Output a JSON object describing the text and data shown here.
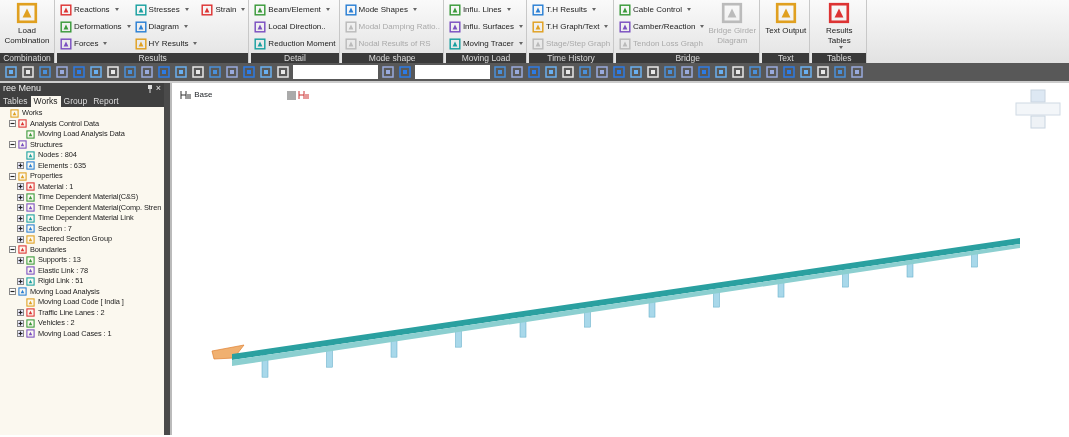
{
  "ribbon": {
    "groups": [
      {
        "label": "Combination",
        "columns": [
          [
            {
              "kind": "large",
              "label": "Load Combination",
              "dropdown": false,
              "disabled": false
            }
          ]
        ]
      },
      {
        "label": "Results",
        "columns": [
          [
            {
              "kind": "small",
              "label": "Reactions",
              "dropdown": true,
              "disabled": false
            },
            {
              "kind": "small",
              "label": "Deformations",
              "dropdown": true,
              "disabled": false
            },
            {
              "kind": "small",
              "label": "Forces",
              "dropdown": true,
              "disabled": false
            }
          ],
          [
            {
              "kind": "small",
              "label": "Stresses",
              "dropdown": true,
              "disabled": false
            },
            {
              "kind": "small",
              "label": "Diagram",
              "dropdown": true,
              "disabled": false
            },
            {
              "kind": "small",
              "label": "HY Results",
              "dropdown": true,
              "disabled": false
            }
          ],
          [
            {
              "kind": "small",
              "label": "Strain",
              "dropdown": true,
              "disabled": false
            }
          ]
        ]
      },
      {
        "label": "Detail",
        "columns": [
          [
            {
              "kind": "small",
              "label": "Beam/Element",
              "dropdown": true,
              "disabled": false
            },
            {
              "kind": "small",
              "label": "Local Direction..",
              "dropdown": false,
              "disabled": false
            },
            {
              "kind": "small",
              "label": "Reduction Moment",
              "dropdown": false,
              "disabled": false
            }
          ]
        ]
      },
      {
        "label": "Mode shape",
        "columns": [
          [
            {
              "kind": "small",
              "label": "Mode Shapes",
              "dropdown": true,
              "disabled": false
            },
            {
              "kind": "small",
              "label": "Modal Damping Ratio..",
              "dropdown": false,
              "disabled": true
            },
            {
              "kind": "small",
              "label": "Nodal Results of RS",
              "dropdown": false,
              "disabled": true
            }
          ]
        ]
      },
      {
        "label": "Moving Load",
        "columns": [
          [
            {
              "kind": "small",
              "label": "Influ. Lines",
              "dropdown": true,
              "disabled": false
            },
            {
              "kind": "small",
              "label": "Influ. Surfaces",
              "dropdown": true,
              "disabled": false
            },
            {
              "kind": "small",
              "label": "Moving Tracer",
              "dropdown": true,
              "disabled": false
            }
          ]
        ]
      },
      {
        "label": "Time History",
        "columns": [
          [
            {
              "kind": "small",
              "label": "T.H Results",
              "dropdown": true,
              "disabled": false
            },
            {
              "kind": "small",
              "label": "T.H Graph/Text",
              "dropdown": true,
              "disabled": false
            },
            {
              "kind": "small",
              "label": "Stage/Step Graph",
              "dropdown": false,
              "disabled": true
            }
          ]
        ]
      },
      {
        "label": "Bridge",
        "columns": [
          [
            {
              "kind": "small",
              "label": "Cable Control",
              "dropdown": true,
              "disabled": false
            },
            {
              "kind": "small",
              "label": "Camber/Reaction",
              "dropdown": true,
              "disabled": false
            },
            {
              "kind": "small",
              "label": "Tendon Loss Graph",
              "dropdown": false,
              "disabled": true
            }
          ],
          [
            {
              "kind": "large",
              "label": "Bridge Girder Diagram",
              "dropdown": false,
              "disabled": true
            }
          ]
        ]
      },
      {
        "label": "Text",
        "columns": [
          [
            {
              "kind": "large",
              "label": "Text Output",
              "dropdown": false,
              "disabled": false
            }
          ]
        ]
      },
      {
        "label": "Tables",
        "columns": [
          [
            {
              "kind": "large",
              "label": "Results Tables",
              "dropdown": true,
              "disabled": false
            }
          ]
        ]
      }
    ]
  },
  "tree_panel": {
    "title": "ree Menu",
    "close": "×",
    "tabs": [
      {
        "label": "Tables",
        "selected": false
      },
      {
        "label": "Works",
        "selected": true
      },
      {
        "label": "Group",
        "selected": false
      },
      {
        "label": "Report",
        "selected": false
      }
    ],
    "items": [
      {
        "label": "Works",
        "children": [
          {
            "label": "Analysis Control Data",
            "expanded": true,
            "children": [
              {
                "label": "Moving Load Analysis Data"
              }
            ]
          },
          {
            "label": "Structures",
            "expanded": true,
            "children": [
              {
                "label": "Nodes : 804"
              },
              {
                "label": "Elements : 635",
                "expanded": false
              }
            ]
          },
          {
            "label": "Properties",
            "expanded": true,
            "children": [
              {
                "label": "Material : 1",
                "expanded": false
              },
              {
                "label": "Time Dependent Material(C&S)",
                "expanded": false
              },
              {
                "label": "Time Dependent Material(Comp. Stren",
                "expanded": false
              },
              {
                "label": "Time Dependent Material Link",
                "expanded": false
              },
              {
                "label": "Section : 7",
                "expanded": false
              },
              {
                "label": "Tapered Section Group",
                "expanded": false
              }
            ]
          },
          {
            "label": "Boundaries",
            "expanded": true,
            "children": [
              {
                "label": "Supports : 13",
                "expanded": false
              },
              {
                "label": "Elastic Link : 78"
              },
              {
                "label": "Rigid Link : 51",
                "expanded": false
              }
            ]
          },
          {
            "label": "Moving Load Analysis",
            "expanded": true,
            "children": [
              {
                "label": "Moving Load Code [ India ]"
              },
              {
                "label": "Traffic Line Lanes : 2",
                "expanded": false
              },
              {
                "label": "Vehicles : 2",
                "expanded": false
              },
              {
                "label": "Moving Load Cases : 1",
                "expanded": false
              }
            ]
          }
        ]
      }
    ]
  },
  "viewport": {
    "base_label": "Base"
  }
}
